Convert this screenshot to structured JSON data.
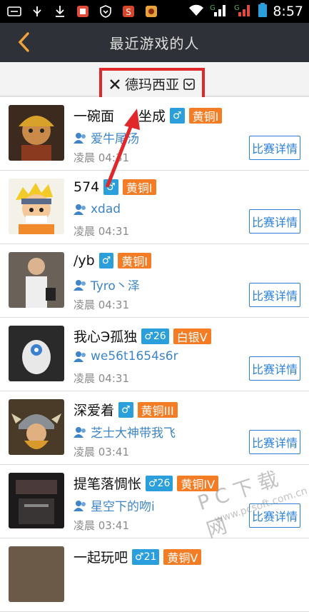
{
  "status_bar": {
    "time": "8:57",
    "signal_labels": [
      "G",
      "G"
    ]
  },
  "header": {
    "title": "最近游戏的人"
  },
  "filter": {
    "label": "德玛西亚"
  },
  "players": [
    {
      "name": "一碗面",
      "name_extra": "坐成",
      "gender": "♂",
      "rank": "黄铜I",
      "friend": "爱牛尾汤",
      "time": "凌晨 04:31",
      "button": "比赛详情"
    },
    {
      "name": "574",
      "name_extra": "",
      "gender": "♂",
      "rank": "黄铜I",
      "friend": "xdad",
      "time": "凌晨 04:31",
      "button": "比赛详情"
    },
    {
      "name": "/yb",
      "name_extra": "",
      "gender": "♂",
      "rank": "黄铜I",
      "friend": "Tyro丶泽",
      "time": "凌晨 04:31",
      "button": "比赛详情"
    },
    {
      "name": "我心Э孤独",
      "name_extra": "",
      "gender": "♂26",
      "rank": "白银V",
      "friend": "we56t1654s6r",
      "time": "凌晨 04:31",
      "button": "比赛详情"
    },
    {
      "name": "深爱着",
      "name_extra": "",
      "gender": "♂",
      "rank": "黄铜III",
      "friend": "芝士大神带我飞",
      "time": "凌晨 03:41",
      "button": "比赛详情"
    },
    {
      "name": "提笔落惆怅",
      "name_extra": "",
      "gender": "♂26",
      "rank": "黄铜IV",
      "friend": "星空下的吻i",
      "time": "凌晨 03:41",
      "button": "比赛详情"
    },
    {
      "name": "一起玩吧",
      "name_extra": "",
      "gender": "♂21",
      "rank": "黄铜V",
      "friend": "",
      "time": "",
      "button": ""
    }
  ],
  "watermark": {
    "text": "PC下载网",
    "url": "www.pcsoft.com.cn"
  },
  "colors": {
    "appbar": "#2f3138",
    "accent_blue": "#2d82d6",
    "rank_orange": "#f37c25",
    "highlight_red": "#e0272a"
  }
}
